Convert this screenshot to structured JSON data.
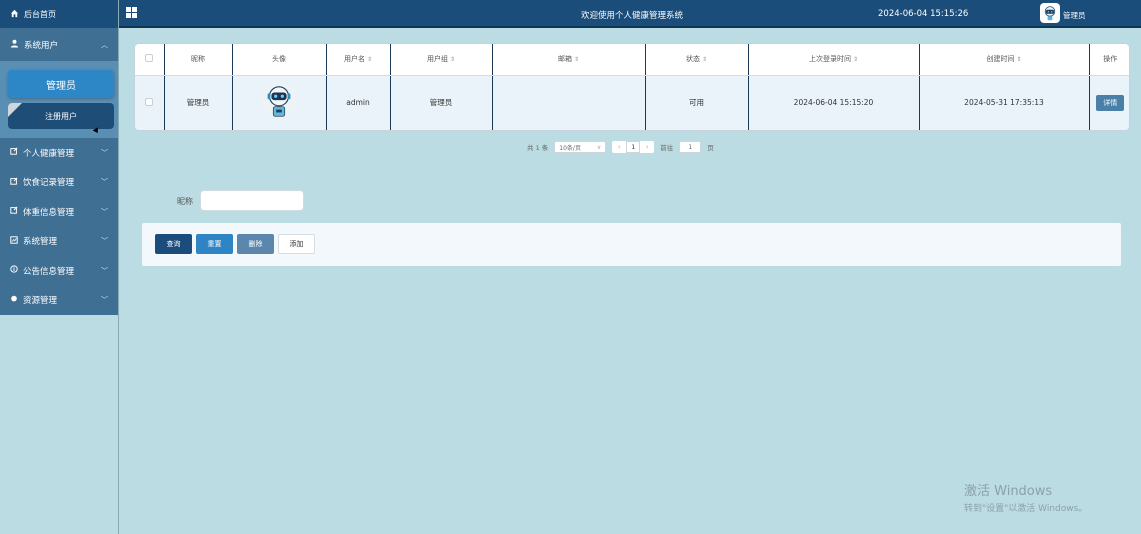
{
  "sidebar": {
    "home_label": "后台首页",
    "system_users": {
      "label": "系统用户",
      "items": [
        "管理员",
        "注册用户"
      ]
    },
    "menus": [
      "个人健康管理",
      "饮食记录管理",
      "体重信息管理",
      "系统管理",
      "公告信息管理",
      "资源管理"
    ]
  },
  "header": {
    "title": "欢迎使用个人健康管理系统",
    "datetime": "2024-06-04 15:15:26",
    "user": "管理员"
  },
  "table": {
    "headers": [
      "昵称",
      "头像",
      "用户名",
      "用户组",
      "邮箱",
      "状态",
      "上次登录时间",
      "创建时间",
      "操作"
    ],
    "rows": [
      {
        "nickname": "管理员",
        "username": "admin",
        "group": "管理员",
        "email": "",
        "status": "可用",
        "last_login": "2024-06-04 15:15:20",
        "created": "2024-05-31 17:35:13",
        "action": "详情"
      }
    ]
  },
  "pagination": {
    "total": "共 1 条",
    "page_size": "10条/页",
    "current": "1",
    "goto_label": "前往",
    "goto_value": "1",
    "page_unit": "页"
  },
  "search": {
    "label": "昵称",
    "value": ""
  },
  "actions": {
    "query": "查询",
    "reset": "重置",
    "delete": "删除",
    "add": "添加"
  },
  "watermark": {
    "line1": "激活 Windows",
    "line2": "转到\"设置\"以激活 Windows。"
  },
  "colors": {
    "header": "#1a4d7a",
    "background": "#bcdce4",
    "accent": "#2d86c5"
  }
}
